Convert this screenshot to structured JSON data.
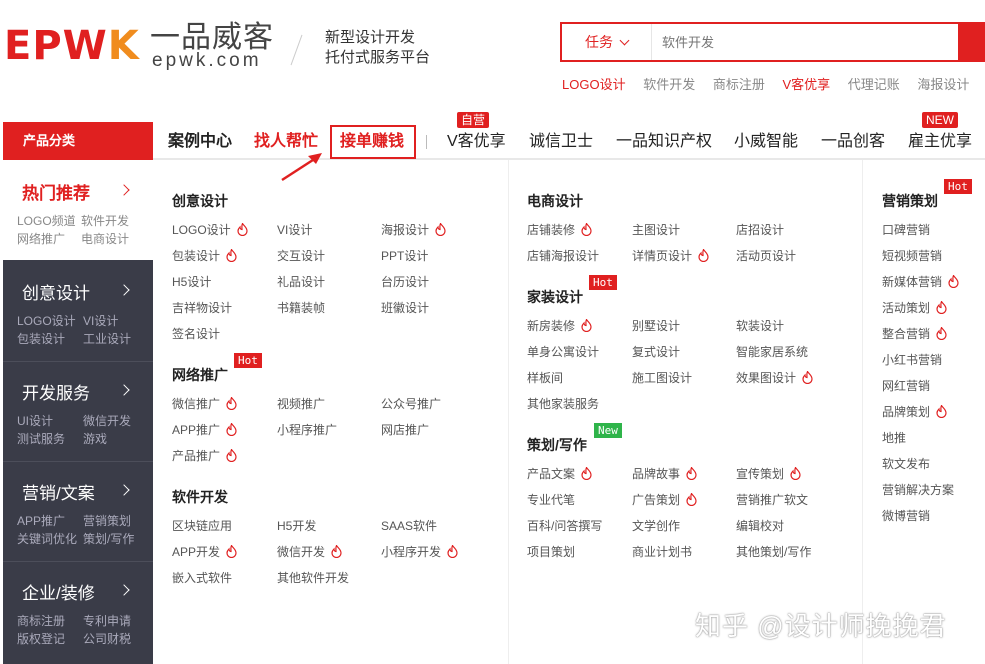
{
  "header": {
    "logo_part1": "EPW",
    "logo_part2": "K",
    "logo_cn": "一品威客",
    "logo_domain": "epwk.com",
    "slogan_line1": "新型设计开发",
    "slogan_line2": "托付式服务平台",
    "search_type": "任务",
    "search_placeholder": "软件开发",
    "hot_links": [
      "LOGO设计",
      "软件开发",
      "商标注册",
      "V客优享",
      "代理记账",
      "海报设计"
    ]
  },
  "nav": {
    "category_label": "产品分类",
    "items": [
      "案例中心",
      "找人帮忙",
      "接单赚钱",
      "V客优享",
      "诚信卫士",
      "一品知识产权",
      "小威智能",
      "一品创客",
      "雇主优享"
    ],
    "tag_self": "自营",
    "tag_new": "NEW"
  },
  "sidebar": [
    {
      "title": "热门推荐",
      "sub1": [
        "LOGO频道",
        "软件开发"
      ],
      "sub2": [
        "网络推广",
        "电商设计"
      ]
    },
    {
      "title": "创意设计",
      "sub1": [
        "LOGO设计",
        "VI设计"
      ],
      "sub2": [
        "包装设计",
        "工业设计"
      ]
    },
    {
      "title": "开发服务",
      "sub1": [
        "UI设计",
        "微信开发"
      ],
      "sub2": [
        "测试服务",
        "游戏"
      ]
    },
    {
      "title": "营销/文案",
      "sub1": [
        "APP推广",
        "营销策划"
      ],
      "sub2": [
        "关键词优化",
        "策划/写作"
      ]
    },
    {
      "title": "企业/装修",
      "sub1": [
        "商标注册",
        "专利申请"
      ],
      "sub2": [
        "版权登记",
        "公司财税"
      ]
    }
  ],
  "sections": {
    "creative": {
      "title": "创意设计",
      "items": [
        "LOGO设计",
        "VI设计",
        "海报设计",
        "包装设计",
        "交互设计",
        "PPT设计",
        "H5设计",
        "礼品设计",
        "台历设计",
        "吉祥物设计",
        "书籍装帧",
        "班徽设计",
        "签名设计"
      ]
    },
    "network": {
      "title": "网络推广",
      "badge": "Hot",
      "items": [
        "微信推广",
        "视频推广",
        "公众号推广",
        "APP推广",
        "小程序推广",
        "网店推广",
        "产品推广"
      ]
    },
    "software": {
      "title": "软件开发",
      "items": [
        "区块链应用",
        "H5开发",
        "SAAS软件",
        "APP开发",
        "微信开发",
        "小程序开发",
        "嵌入式软件",
        "其他软件开发"
      ]
    },
    "ecommerce": {
      "title": "电商设计",
      "items": [
        "店铺装修",
        "主图设计",
        "店招设计",
        "店铺海报设计",
        "详情页设计",
        "活动页设计"
      ]
    },
    "home": {
      "title": "家装设计",
      "badge": "Hot",
      "items": [
        "新房装修",
        "别墅设计",
        "软装设计",
        "单身公寓设计",
        "复式设计",
        "智能家居系统",
        "样板间",
        "施工图设计",
        "效果图设计",
        "其他家装服务"
      ]
    },
    "writing": {
      "title": "策划/写作",
      "badge": "New",
      "items": [
        "产品文案",
        "品牌故事",
        "宣传策划",
        "专业代笔",
        "广告策划",
        "营销推广软文",
        "百科/问答撰写",
        "文学创作",
        "编辑校对",
        "项目策划",
        "商业计划书",
        "其他策划/写作"
      ]
    },
    "marketing": {
      "title": "营销策划",
      "badge": "Hot",
      "items": [
        "口碑营销",
        "短视频营销",
        "新媒体营销",
        "活动策划",
        "整合营销",
        "小红书营销",
        "网红营销",
        "品牌策划",
        "地推",
        "软文发布",
        "营销解决方案",
        "微博营销"
      ]
    }
  },
  "watermark": "知乎 @设计师挽挽君"
}
